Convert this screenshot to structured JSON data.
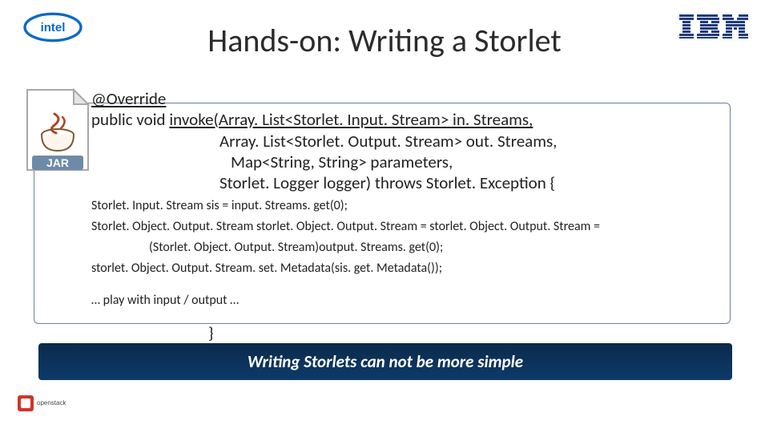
{
  "title": "Hands-on: Writing a Storlet",
  "code": {
    "l1": "@Override",
    "l2a": "public void ",
    "l2b": "invoke(Array. List<Storlet. Input. Stream> in. Streams,",
    "l3": "Array. List<Storlet. Output. Stream> out. Streams,",
    "l4": "Map<String, String> parameters,",
    "l5": "Storlet. Logger logger) throws Storlet. Exception {",
    "s1": "Storlet. Input. Stream sis = input. Streams. get(0);",
    "s2": "Storlet. Object. Output. Stream storlet. Object. Output. Stream = storlet. Object. Output. Stream =",
    "s3": "(Storlet. Object. Output. Stream)output. Streams. get(0);",
    "s4": "storlet. Object. Output. Stream. set. Metadata(sis. get. Metadata());",
    "play": "… play with input / output …",
    "close": "}"
  },
  "banner": "Writing Storlets can not be more simple",
  "logos": {
    "intel_text": "intel",
    "ibm": "IBM",
    "jar_label": "JAR",
    "openstack": "openstack"
  }
}
